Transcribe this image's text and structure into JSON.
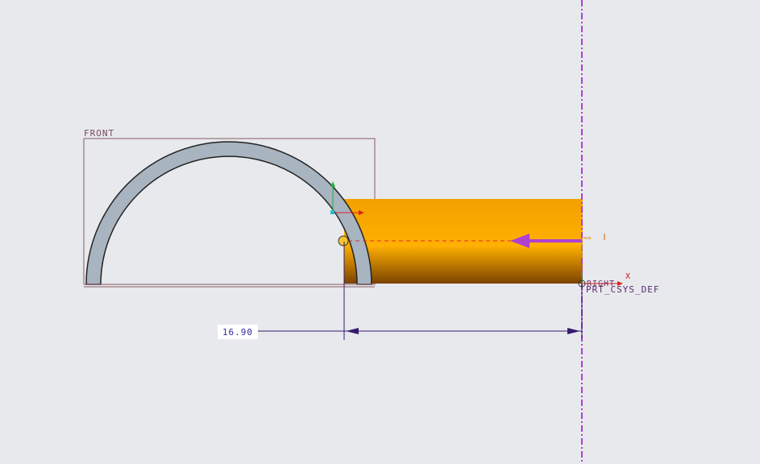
{
  "viewport": {
    "datum_planes": {
      "front_label": "FRONT",
      "right_label": "RIGHT"
    },
    "csys": {
      "label": "PRT_CSYS_DEF",
      "x_axis_label": "X"
    },
    "dimension": {
      "value": "16.90"
    },
    "colors": {
      "background": "#e7e9ec",
      "cylinder": "#f5a300",
      "half_ring_fill": "#a8b4c0",
      "datum_plane_right": "#b040d0",
      "dimension": "#3a1a70",
      "drag_handle": "#f4c430",
      "direction_arrow": "#b040d0"
    },
    "icons": [
      "drag-handle-icon",
      "direction-arrow-icon",
      "csys-triad-icon"
    ]
  }
}
